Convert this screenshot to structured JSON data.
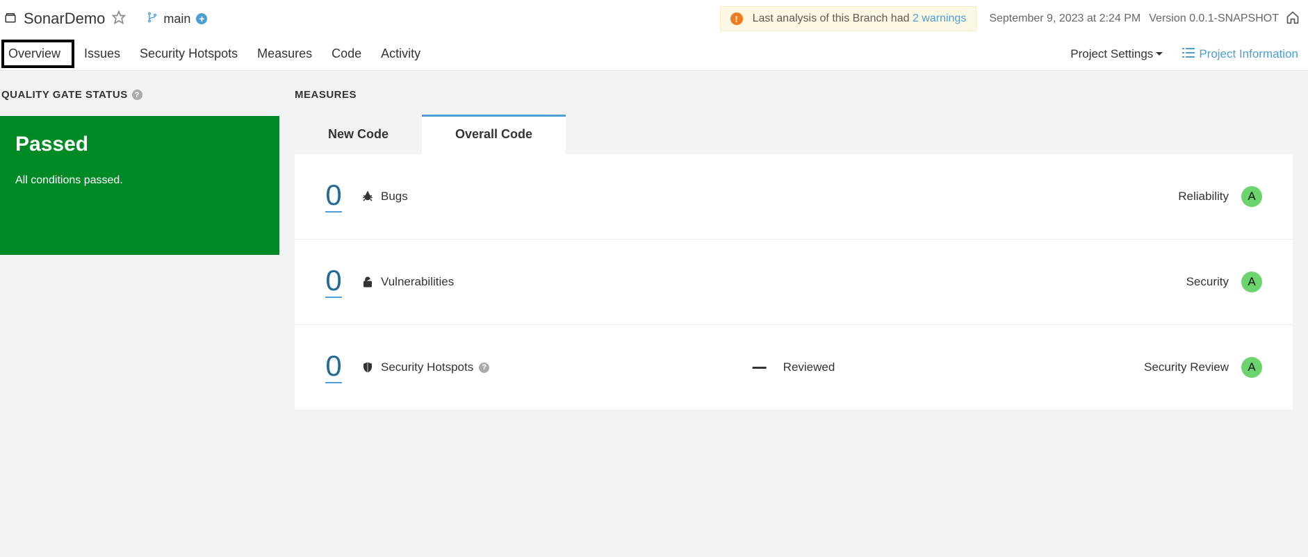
{
  "header": {
    "project_name": "SonarDemo",
    "branch": "main",
    "warning_prefix": "Last analysis of this Branch had ",
    "warning_link": "2 warnings",
    "date": "September 9, 2023 at 2:24 PM",
    "version": "Version 0.0.1-SNAPSHOT"
  },
  "nav": {
    "items": [
      "Overview",
      "Issues",
      "Security Hotspots",
      "Measures",
      "Code",
      "Activity"
    ],
    "settings": "Project Settings",
    "project_info": "Project Information"
  },
  "quality_gate": {
    "title": "QUALITY GATE STATUS",
    "status": "Passed",
    "subtitle": "All conditions passed."
  },
  "measures": {
    "title": "MEASURES",
    "tabs": [
      "New Code",
      "Overall Code"
    ],
    "rows": [
      {
        "value": "0",
        "label": "Bugs",
        "rating_label": "Reliability",
        "rating": "A"
      },
      {
        "value": "0",
        "label": "Vulnerabilities",
        "rating_label": "Security",
        "rating": "A"
      },
      {
        "value": "0",
        "label": "Security Hotspots",
        "mid_label": "Reviewed",
        "rating_label": "Security Review",
        "rating": "A"
      }
    ]
  }
}
